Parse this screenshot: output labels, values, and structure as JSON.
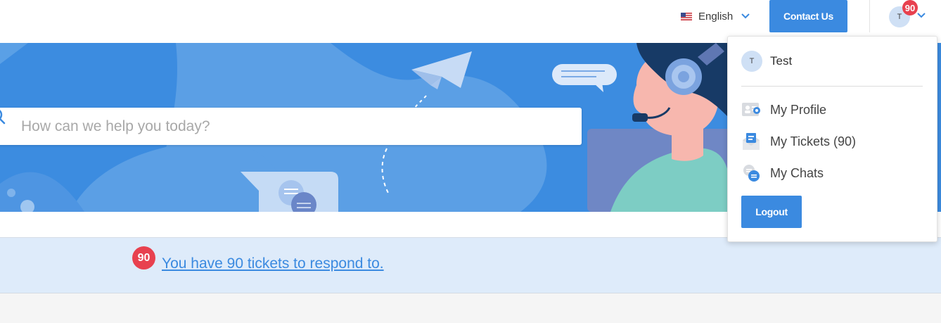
{
  "header": {
    "language": {
      "label": "English",
      "flag_icon": "us-flag-icon"
    },
    "contact_button": "Contact Us",
    "user": {
      "initial": "T",
      "badge_count": "90"
    }
  },
  "hero": {
    "search": {
      "placeholder": "How can we help you today?",
      "value": ""
    }
  },
  "notice": {
    "badge_count": "90",
    "link_text": "You have 90 tickets to respond to."
  },
  "user_dropdown": {
    "avatar_initial": "T",
    "username": "Test",
    "items": [
      {
        "label": "My Profile",
        "icon": "profile-card-icon"
      },
      {
        "label": "My Tickets (90)",
        "icon": "tickets-icon"
      },
      {
        "label": "My Chats",
        "icon": "chats-icon"
      }
    ],
    "logout_label": "Logout"
  },
  "colors": {
    "accent": "#3b8ae0",
    "badge": "#e8414f",
    "hero_bg": "#3c8ce0",
    "notice_bg": "#deebfa"
  }
}
